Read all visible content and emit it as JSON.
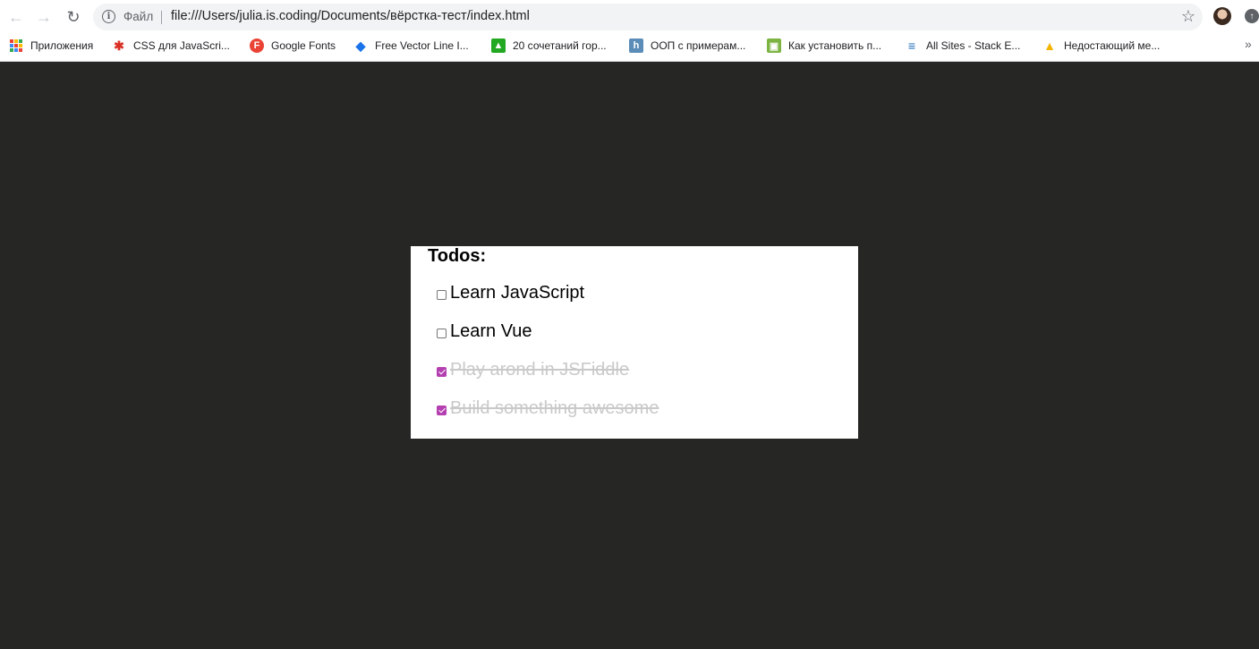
{
  "browser": {
    "scheme_label": "Файл",
    "url": "file:///Users/julia.is.coding/Documents/вёрстка-тест/index.html",
    "bookmarks": [
      {
        "label": "Приложения"
      },
      {
        "label": "CSS для JavaScri..."
      },
      {
        "label": "Google Fonts"
      },
      {
        "label": "Free Vector Line I..."
      },
      {
        "label": "20 сочетаний гор..."
      },
      {
        "label": "ООП с примерам..."
      },
      {
        "label": "Как установить п..."
      },
      {
        "label": "All Sites - Stack E..."
      },
      {
        "label": "Недостающий ме..."
      }
    ]
  },
  "todos": {
    "title": "Todos:",
    "items": [
      {
        "text": "Learn JavaScript",
        "done": false
      },
      {
        "text": "Learn Vue",
        "done": false
      },
      {
        "text": "Play arond in JSFiddle",
        "done": true
      },
      {
        "text": "Build something awesome",
        "done": true
      }
    ]
  },
  "colors": {
    "page_background": "#262624",
    "card_background": "#ffffff",
    "checkbox_accent": "#b43fb0",
    "done_text": "#c9c9c9"
  }
}
